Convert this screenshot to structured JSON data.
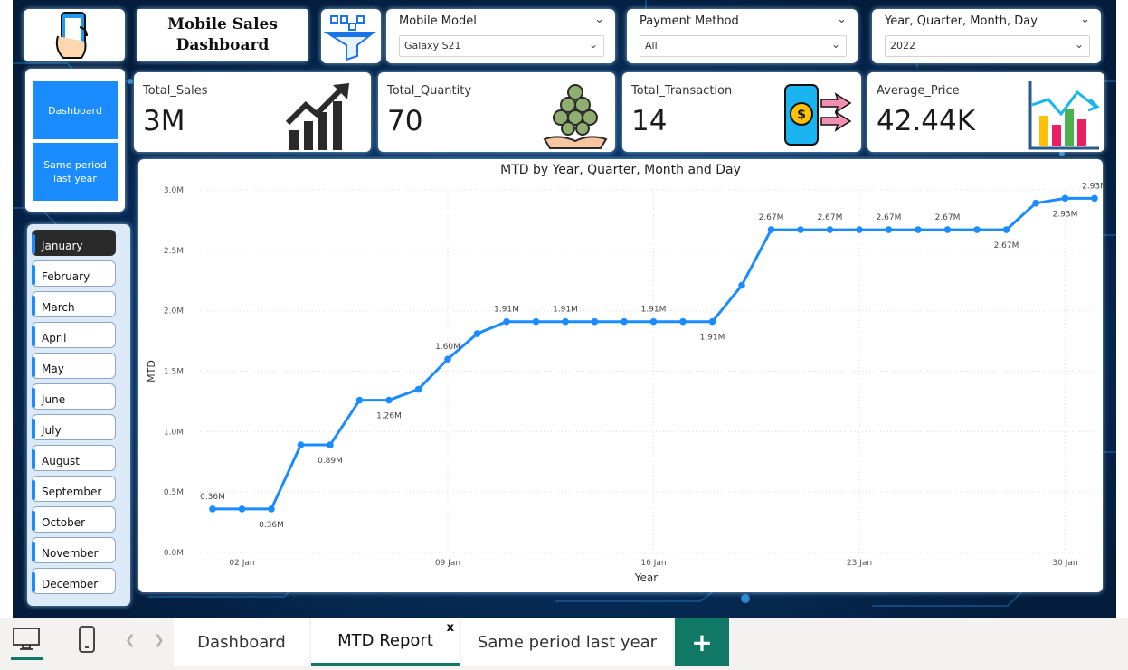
{
  "header": {
    "title_line1": "Mobile Sales",
    "title_line2": "Dashboard"
  },
  "icons": {
    "logo": "phone-in-hand-icon",
    "filter": "funnel-filter-icon",
    "sales": "growth-chart-icon",
    "quantity": "coins-hand-icon",
    "transaction": "mobile-payment-icon",
    "price": "bar-trend-icon"
  },
  "slicers": [
    {
      "label": "Mobile Model",
      "value": "Galaxy S21"
    },
    {
      "label": "Payment Method",
      "value": "All"
    },
    {
      "label": "Year, Quarter, Month, Day",
      "value": "2022"
    }
  ],
  "kpis": [
    {
      "label": "Total_Sales",
      "value": "3M"
    },
    {
      "label": "Total_Quantity",
      "value": "70"
    },
    {
      "label": "Total_Transaction",
      "value": "14"
    },
    {
      "label": "Average_Price",
      "value": "42.44K"
    }
  ],
  "nav": {
    "dashboard": "Dashboard",
    "same_period": "Same period last year"
  },
  "months": [
    "January",
    "February",
    "March",
    "April",
    "May",
    "June",
    "July",
    "August",
    "September",
    "October",
    "November",
    "December"
  ],
  "selected_month": "January",
  "colors": {
    "accent": "#1a8cff",
    "line": "#1a8cff",
    "background": "#062a55",
    "tab_active": "#117865"
  },
  "chart_data": {
    "type": "line",
    "title": "MTD by Year, Quarter, Month and Day",
    "xlabel": "Year",
    "ylabel": "MTD",
    "x_ticks": [
      "02 Jan",
      "09 Jan",
      "16 Jan",
      "23 Jan",
      "30 Jan"
    ],
    "y_ticks": [
      "0.0M",
      "0.5M",
      "1.0M",
      "1.5M",
      "2.0M",
      "2.5M",
      "3.0M"
    ],
    "ylim": [
      0,
      3.0
    ],
    "grid": true,
    "x": [
      "01 Jan",
      "02 Jan",
      "03 Jan",
      "04 Jan",
      "05 Jan",
      "06 Jan",
      "07 Jan",
      "08 Jan",
      "09 Jan",
      "10 Jan",
      "11 Jan",
      "12 Jan",
      "13 Jan",
      "14 Jan",
      "15 Jan",
      "16 Jan",
      "17 Jan",
      "18 Jan",
      "19 Jan",
      "20 Jan",
      "21 Jan",
      "22 Jan",
      "23 Jan",
      "24 Jan",
      "25 Jan",
      "26 Jan",
      "27 Jan",
      "28 Jan",
      "29 Jan",
      "30 Jan",
      "31 Jan"
    ],
    "values": [
      0.36,
      0.36,
      0.36,
      0.89,
      0.89,
      1.26,
      1.26,
      1.35,
      1.6,
      1.81,
      1.91,
      1.91,
      1.91,
      1.91,
      1.91,
      1.91,
      1.91,
      1.91,
      2.21,
      2.67,
      2.67,
      2.67,
      2.67,
      2.67,
      2.67,
      2.67,
      2.67,
      2.67,
      2.89,
      2.93,
      2.93
    ],
    "data_labels": [
      {
        "i": 0,
        "text": "0.36M",
        "pos": "above"
      },
      {
        "i": 2,
        "text": "0.36M",
        "pos": "below"
      },
      {
        "i": 4,
        "text": "0.89M",
        "pos": "below"
      },
      {
        "i": 6,
        "text": "1.26M",
        "pos": "below"
      },
      {
        "i": 8,
        "text": "1.60M",
        "pos": "above"
      },
      {
        "i": 10,
        "text": "1.91M",
        "pos": "above"
      },
      {
        "i": 12,
        "text": "1.91M",
        "pos": "above"
      },
      {
        "i": 15,
        "text": "1.91M",
        "pos": "above"
      },
      {
        "i": 17,
        "text": "1.91M",
        "pos": "below"
      },
      {
        "i": 19,
        "text": "2.67M",
        "pos": "above"
      },
      {
        "i": 21,
        "text": "2.67M",
        "pos": "above"
      },
      {
        "i": 23,
        "text": "2.67M",
        "pos": "above"
      },
      {
        "i": 25,
        "text": "2.67M",
        "pos": "above"
      },
      {
        "i": 27,
        "text": "2.67M",
        "pos": "below"
      },
      {
        "i": 29,
        "text": "2.93M",
        "pos": "below"
      },
      {
        "i": 30,
        "text": "2.93M",
        "pos": "above"
      }
    ]
  },
  "tabs": [
    {
      "label": "Dashboard"
    },
    {
      "label": "MTD Report",
      "close": "x"
    },
    {
      "label": "Same period last year"
    }
  ],
  "add_tab": "+"
}
